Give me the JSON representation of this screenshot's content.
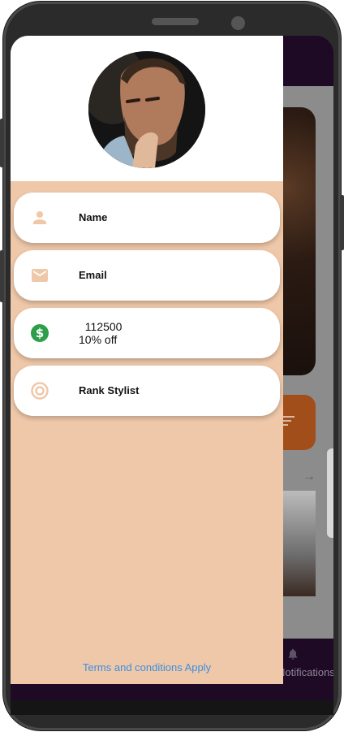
{
  "drawer": {
    "menu_items": [
      {
        "label": "Name",
        "icon": "person-icon"
      },
      {
        "label": "Email",
        "icon": "mail-icon"
      },
      {
        "lines": [
          "  112500",
          "10% off"
        ],
        "icon": "dollar-icon"
      },
      {
        "label": "Rank Stylist",
        "icon": "target-icon"
      }
    ],
    "footer_link": "Terms and conditions Apply"
  },
  "background": {
    "bottom_nav_label": "Notifications",
    "arrow_glyph": "→"
  },
  "colors": {
    "drawer_bg": "#efc8a9",
    "icon_tint": "#efc8a9",
    "dollar_green": "#2e9e4a",
    "link_blue": "#3d8ee0",
    "app_dark": "#1e0a25"
  }
}
